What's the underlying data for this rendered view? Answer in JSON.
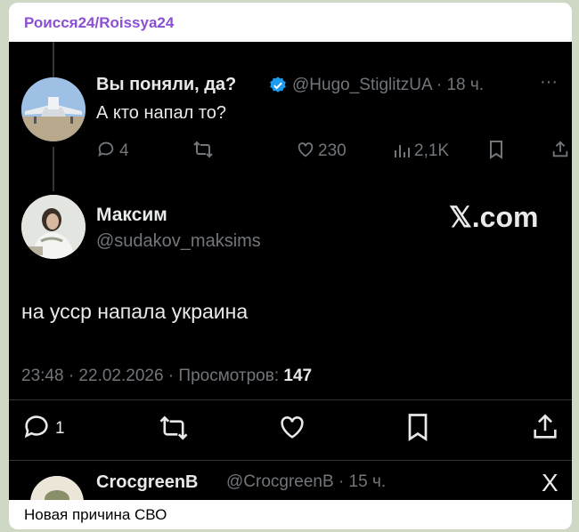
{
  "channel": {
    "name": "Роисся24/Roissya24"
  },
  "caption": "Новая причина СВО",
  "quoted_tweet": {
    "author_name": "Вы поняли, да?",
    "handle_time": "@Hugo_StiglitzUA · 18 ч.",
    "more": "···",
    "text": "А кто напал то?",
    "replies": "4",
    "likes": "230",
    "views": "2,1K"
  },
  "main_tweet": {
    "author_name": "Максим",
    "handle": "@sudakov_maksims",
    "watermark": "𝕏.com",
    "text": "на усср напала украина",
    "meta_time": "23:48 · 22.02.2026 · Просмотров: ",
    "meta_views": "147",
    "replies": "1"
  },
  "next_tweet": {
    "author_name": "CrocgreenB",
    "handle_time": "@CrocgreenB · 15 ч.",
    "logo": "X"
  },
  "colors": {
    "channel": "#8b4fd1",
    "verified": "#1d9bf0",
    "muted": "#71767b",
    "text": "#e7e9ea",
    "background": "#000000"
  },
  "icons": [
    "verified-badge-icon",
    "reply-icon",
    "retweet-icon",
    "like-icon",
    "views-icon",
    "bookmark-icon",
    "share-icon",
    "x-logo-icon"
  ]
}
